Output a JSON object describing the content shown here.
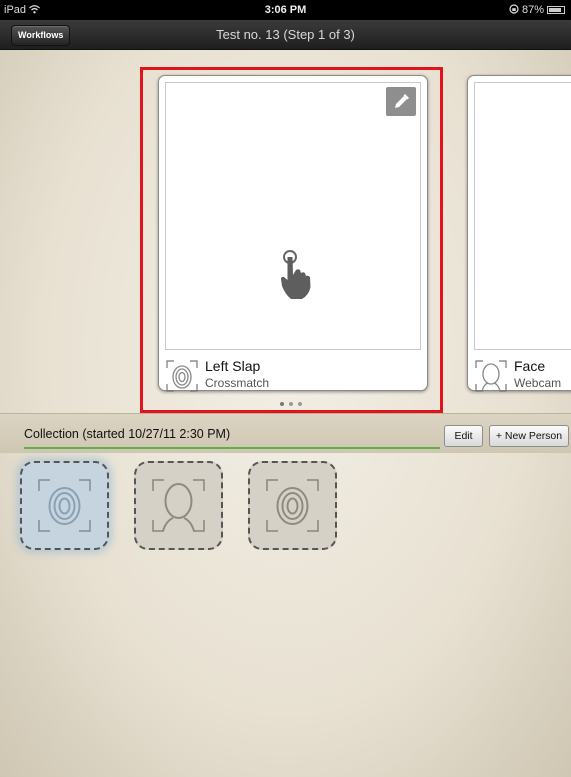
{
  "status_bar": {
    "device": "iPad",
    "time": "3:06 PM",
    "battery": "87%"
  },
  "nav": {
    "back_button": "Workflows",
    "title": "Test no. 13 (Step 1 of 3)"
  },
  "cards": [
    {
      "title": "Left Slap",
      "subtitle": "Crossmatch",
      "icon": "fingerprint-icon",
      "action_icon": "pencil-icon",
      "hint_icon": "hand-tap-icon"
    },
    {
      "title": "Face",
      "subtitle": "Webcam",
      "icon": "face-icon"
    }
  ],
  "pager": {
    "pages": 3,
    "current": 1
  },
  "collection": {
    "label": "Collection (started 10/27/11 2:30 PM)",
    "edit_label": "Edit",
    "new_person_label": "+ New Person"
  },
  "slots": [
    {
      "icon": "fingerprint-icon",
      "state": "active"
    },
    {
      "icon": "face-icon",
      "state": "inactive"
    },
    {
      "icon": "fingerprint-icon",
      "state": "inactive"
    }
  ],
  "colors": {
    "highlight": "#e0141a",
    "progress_line": "#5db246",
    "active_slot": "#c6d4df"
  }
}
